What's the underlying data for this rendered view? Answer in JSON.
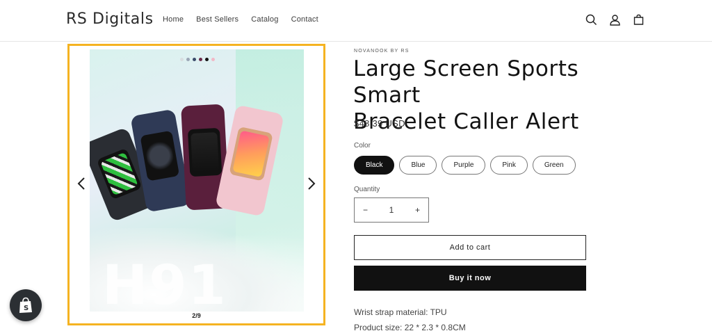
{
  "header": {
    "logo": "RS Digitals",
    "nav": [
      "Home",
      "Best Sellers",
      "Catalog",
      "Contact"
    ],
    "icons": [
      "search-icon",
      "account-icon",
      "cart-icon"
    ]
  },
  "gallery": {
    "image_text": "H91",
    "slide_counter": "2/9",
    "prev_icon": "chevron-left-icon",
    "next_icon": "chevron-right-icon",
    "frame_color": "#f5b321"
  },
  "product": {
    "vendor": "NOVANOOK BY RS",
    "title_line1": "Large Screen Sports Smart",
    "title_line2": "Bracelet Caller Alert",
    "price": "$48.39 USD",
    "color_label": "Color",
    "colors": [
      "Black",
      "Blue",
      "Purple",
      "Pink",
      "Green"
    ],
    "selected_color": "Black",
    "quantity_label": "Quantity",
    "quantity": "1",
    "minus": "−",
    "plus": "+",
    "add_to_cart": "Add to cart",
    "buy_now": "Buy it now",
    "description": [
      "Wrist strap material: TPU",
      "Product size: 22 * 2.3 * 0.8CM"
    ]
  },
  "floating": {
    "icon": "shopify-bag-icon"
  }
}
